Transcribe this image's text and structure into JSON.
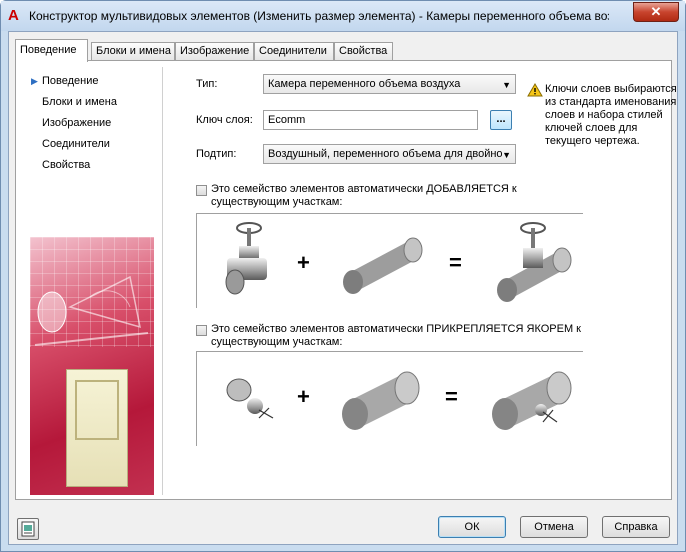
{
  "window": {
    "title": "Конструктор мультивидовых элементов (Изменить размер элемента) - Камеры переменного объема возд...",
    "app_icon": "A",
    "close_glyph": "✕"
  },
  "tabs": [
    {
      "label": "Поведение"
    },
    {
      "label": "Блоки и имена"
    },
    {
      "label": "Изображение"
    },
    {
      "label": "Соединители"
    },
    {
      "label": "Свойства"
    }
  ],
  "nav": [
    {
      "label": "Поведение",
      "active": true
    },
    {
      "label": "Блоки и имена"
    },
    {
      "label": "Изображение"
    },
    {
      "label": "Соединители"
    },
    {
      "label": "Свойства"
    }
  ],
  "form": {
    "type_label": "Тип:",
    "type_value": "Камера переменного объема воздуха",
    "layer_key_label": "Ключ слоя:",
    "layer_key_value": "Ecomm",
    "browse_label": "...",
    "subtype_label": "Подтип:",
    "subtype_value": "Воздушный, переменного объема для двойно",
    "hint": "Ключи слоев выбираются из стандарта именования слоев и набора стилей ключей слоев для текущего чертежа."
  },
  "options": {
    "add_label": "Это семейство элементов автоматически ДОБАВЛЯЕТСЯ к существующим участкам:",
    "anchor_label": "Это семейство элементов автоматически ПРИКРЕПЛЯЕТСЯ ЯКОРЕМ к существующим участкам:",
    "plus": "+",
    "equals": "="
  },
  "buttons": {
    "ok": "ОК",
    "cancel": "Отмена",
    "help": "Справка"
  },
  "colors": {
    "accent": "#2e6fc2",
    "close": "#c8442e"
  }
}
